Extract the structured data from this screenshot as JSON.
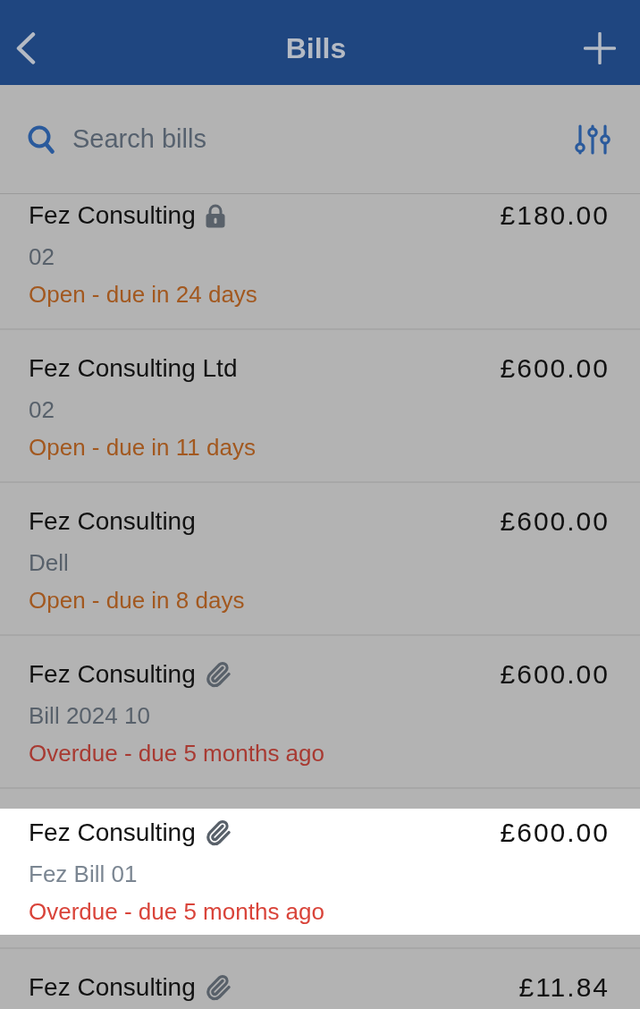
{
  "header": {
    "title": "Bills"
  },
  "search": {
    "placeholder": "Search bills"
  },
  "bills": [
    {
      "supplier": "Fez Consulting",
      "locked": true,
      "has_attachment": false,
      "reference": "02",
      "status": "Open - due in 24 days",
      "overdue": false,
      "amount": "£180.00",
      "selected": false
    },
    {
      "supplier": "Fez Consulting Ltd",
      "locked": false,
      "has_attachment": false,
      "reference": "02",
      "status": "Open - due in 11 days",
      "overdue": false,
      "amount": "£600.00",
      "selected": false
    },
    {
      "supplier": "Fez Consulting",
      "locked": false,
      "has_attachment": false,
      "reference": "Dell",
      "status": "Open - due in 8 days",
      "overdue": false,
      "amount": "£600.00",
      "selected": false
    },
    {
      "supplier": "Fez Consulting",
      "locked": false,
      "has_attachment": true,
      "reference": "Bill 2024 10",
      "status": "Overdue - due 5 months ago",
      "overdue": true,
      "amount": "£600.00",
      "selected": false
    },
    {
      "supplier": "Fez Consulting",
      "locked": false,
      "has_attachment": true,
      "reference": "Fez Bill 01",
      "status": "Overdue - due 5 months ago",
      "overdue": true,
      "amount": "£600.00",
      "selected": true
    },
    {
      "supplier": "Fez Consulting",
      "locked": false,
      "has_attachment": true,
      "amount": "£11.84",
      "selected": false
    }
  ]
}
